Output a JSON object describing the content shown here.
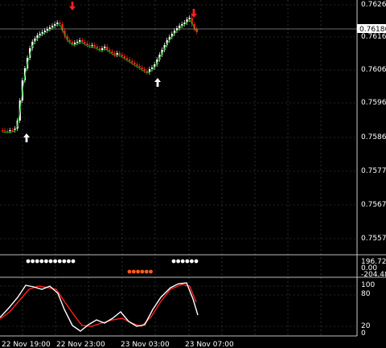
{
  "chart_data": {
    "type": "candlestick",
    "price_axis": {
      "ticks": [
        "0.76260",
        "0.76160",
        "0.76065",
        "0.75965",
        "0.75865",
        "0.75770",
        "0.75670",
        "0.75570"
      ],
      "current_price": "0.76186"
    },
    "time_axis": {
      "ticks": [
        "22 Nov 19:00",
        "22 Nov 23:00",
        "23 Nov 03:00",
        "23 Nov 07:00"
      ]
    },
    "signal_panel": {
      "ticks": [
        "196.726",
        "0.00",
        "-204.484"
      ]
    },
    "oscillator_panel": {
      "ticks": [
        "100",
        "80",
        "20",
        "0"
      ]
    },
    "colors": {
      "background": "#000000",
      "grid": "#4a4a4a",
      "bull": "#ffffff",
      "bear": "#ff2020",
      "ma": "#00b000",
      "signal_red": "#ff2020",
      "dots_bear": "#ff5a1e",
      "dots_bull": "#ffffff",
      "stoch_main": "#ffffff",
      "stoch_signal": "#ff1f1f"
    }
  }
}
